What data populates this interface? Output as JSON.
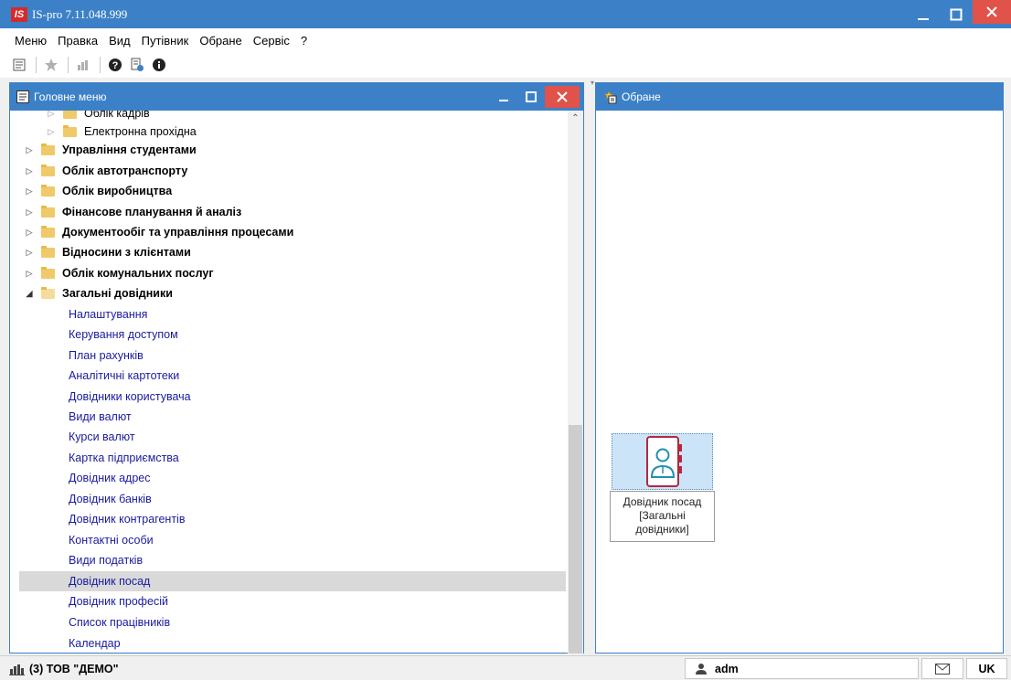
{
  "window": {
    "app_logo": "IS",
    "title": "IS-pro 7.11.048.999"
  },
  "menubar": {
    "items": [
      "Меню",
      "Правка",
      "Вид",
      "Путівник",
      "Обране",
      "Сервіс",
      "?"
    ]
  },
  "toolbar": {
    "icons": [
      "document-icon",
      "star-icon",
      "chart-icon",
      "help-icon",
      "document-help-icon",
      "info-icon"
    ]
  },
  "main_menu": {
    "title": "Головне меню",
    "tree": [
      {
        "label": "Облік кадрів",
        "level": 1,
        "bold": false,
        "type": "folder"
      },
      {
        "label": "Електронна прохідна",
        "level": 1,
        "bold": false,
        "type": "folder"
      },
      {
        "label": "Управління студентами",
        "level": 0,
        "bold": true,
        "type": "folder"
      },
      {
        "label": "Облік автотранспорту",
        "level": 0,
        "bold": true,
        "type": "folder"
      },
      {
        "label": "Облік виробництва",
        "level": 0,
        "bold": true,
        "type": "folder"
      },
      {
        "label": "Фінансове планування й аналіз",
        "level": 0,
        "bold": true,
        "type": "folder"
      },
      {
        "label": "Документообіг та управління процесами",
        "level": 0,
        "bold": true,
        "type": "folder"
      },
      {
        "label": "Відносини з клієнтами",
        "level": 0,
        "bold": true,
        "type": "folder"
      },
      {
        "label": "Облік комунальних послуг",
        "level": 0,
        "bold": true,
        "type": "folder"
      },
      {
        "label": "Загальні довідники",
        "level": 0,
        "bold": true,
        "type": "folder-open"
      },
      {
        "label": "Налаштування",
        "level": 1,
        "type": "leaf"
      },
      {
        "label": "Керування доступом",
        "level": 1,
        "type": "leaf"
      },
      {
        "label": "План рахунків",
        "level": 1,
        "type": "leaf"
      },
      {
        "label": "Аналітичні картотеки",
        "level": 1,
        "type": "leaf"
      },
      {
        "label": "Довідники користувача",
        "level": 1,
        "type": "leaf"
      },
      {
        "label": "Види валют",
        "level": 1,
        "type": "leaf"
      },
      {
        "label": "Курси валют",
        "level": 1,
        "type": "leaf"
      },
      {
        "label": "Картка підприємства",
        "level": 1,
        "type": "leaf"
      },
      {
        "label": "Довідник адрес",
        "level": 1,
        "type": "leaf"
      },
      {
        "label": "Довідник банків",
        "level": 1,
        "type": "leaf"
      },
      {
        "label": "Довідник контрагентів",
        "level": 1,
        "type": "leaf"
      },
      {
        "label": "Контактні особи",
        "level": 1,
        "type": "leaf"
      },
      {
        "label": "Види податків",
        "level": 1,
        "type": "leaf"
      },
      {
        "label": "Довідник посад",
        "level": 1,
        "type": "leaf",
        "selected": true
      },
      {
        "label": "Довідник професій",
        "level": 1,
        "type": "leaf"
      },
      {
        "label": "Список працівників",
        "level": 1,
        "type": "leaf"
      },
      {
        "label": "Календар",
        "level": 1,
        "type": "leaf"
      }
    ]
  },
  "favorites": {
    "title": "Обране",
    "tile": {
      "icon": "address-book-person-icon",
      "line1": "Довідник посад",
      "line2": "[Загальні",
      "line3": "довідники]"
    }
  },
  "statusbar": {
    "company": "(3) ТОВ \"ДЕМО\"",
    "user": "adm",
    "language": "UK"
  },
  "colors": {
    "accent": "#3c81c7",
    "close_button": "#e0524a",
    "selected_row": "#d9d9d9",
    "leaf_text": "#1a1a9e",
    "folder": "#f0c96a"
  }
}
